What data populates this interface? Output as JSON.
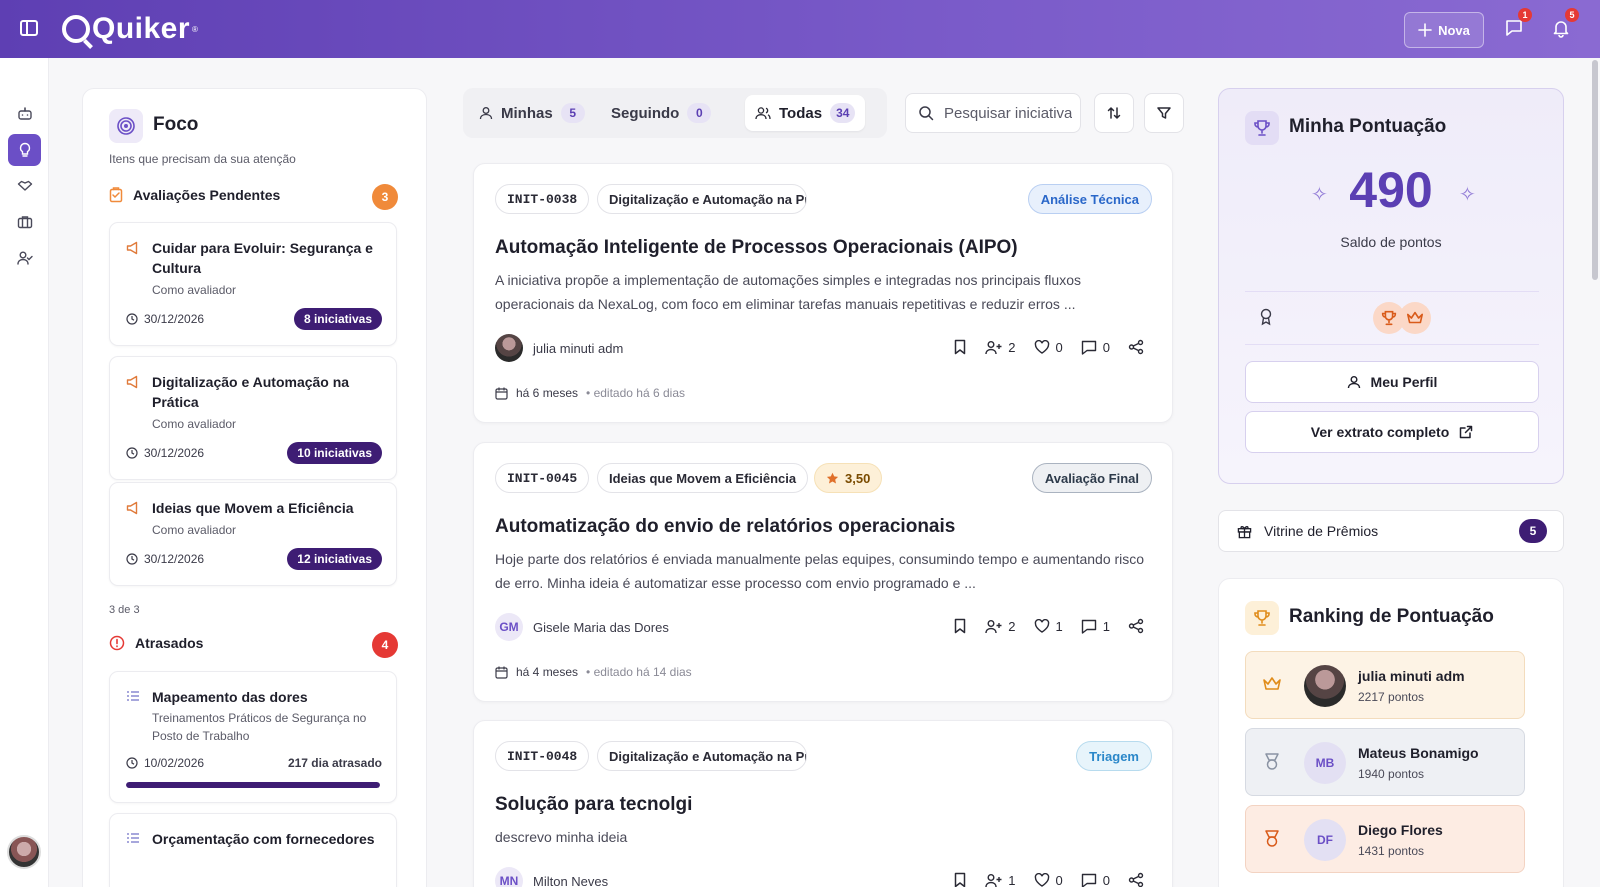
{
  "topbar": {
    "brand": "Quiker",
    "brand_mark": "®",
    "new_button_label": "Nova",
    "messages_badge": "1",
    "notifications_badge": "5"
  },
  "rail": {
    "items": [
      "robot-icon",
      "lightbulb-icon",
      "handshake-icon",
      "briefcase-icon",
      "user-check-icon"
    ]
  },
  "focus": {
    "title": "Foco",
    "subtitle": "Itens que precisam da sua atenção",
    "pending": {
      "title": "Avaliações Pendentes",
      "count": "3",
      "items": [
        {
          "title": "Cuidar para Evoluir: Segurança e Cultura",
          "role": "Como avaliador",
          "date": "30/12/2026",
          "badge": "8 iniciativas"
        },
        {
          "title": "Digitalização e Automação na Prática",
          "role": "Como avaliador",
          "date": "30/12/2026",
          "badge": "10 iniciativas"
        },
        {
          "title": "Ideias que Movem a Eficiência",
          "role": "Como avaliador",
          "date": "30/12/2026",
          "badge": "12 iniciativas"
        }
      ],
      "count_note": "3 de 3"
    },
    "late": {
      "title": "Atrasados",
      "count": "4",
      "items": [
        {
          "title": "Mapeamento das dores",
          "subtitle": "Treinamentos Práticos de Segurança no Posto de Trabalho",
          "date": "10/02/2026",
          "late": "217 dia atrasado",
          "progress": 1.0
        },
        {
          "title": "Orçamentação com fornecedores"
        }
      ]
    }
  },
  "tabs": [
    {
      "label": "Minhas",
      "count": "5"
    },
    {
      "label": "Seguindo",
      "count": "0"
    },
    {
      "label": "Todas",
      "count": "34",
      "active": true
    }
  ],
  "search": {
    "placeholder": "Pesquisar iniciativa"
  },
  "feed": [
    {
      "code": "INIT-0038",
      "campaign": "Digitalização e Automação na Pr",
      "status": "Análise Técnica",
      "title": "Automação Inteligente de Processos Operacionais (AIPO)",
      "desc": "A iniciativa propõe a implementação de automações simples e integradas nos principais fluxos operacionais da NexaLog, com foco em eliminar tarefas manuais repetitivas e reduzir erros ...",
      "author": "julia minuti adm",
      "followers": "2",
      "likes": "0",
      "comments": "0",
      "created": "há 6 meses",
      "edited": "• editado há 6 dias"
    },
    {
      "code": "INIT-0045",
      "campaign": "Ideias que Movem a Eficiência",
      "rating": "3,50",
      "status": "Avaliação Final",
      "title": "Automatização do envio de relatórios operacionais",
      "desc": "Hoje parte dos relatórios é enviada manualmente pelas equipes, consumindo tempo e aumentando risco de erro. Minha ideia é automatizar esse processo com envio programado e ...",
      "author_initials": "GM",
      "author": "Gisele Maria das Dores",
      "followers": "2",
      "likes": "1",
      "comments": "1",
      "created": "há 4 meses",
      "edited": "• editado há 14 dias"
    },
    {
      "code": "INIT-0048",
      "campaign": "Digitalização e Automação na Pr",
      "status": "Triagem",
      "title": "Solução para tecnolgi",
      "desc": "descrevo minha ideia",
      "author_initials": "MN",
      "author": "Milton Neves",
      "followers": "1",
      "likes": "0",
      "comments": "0"
    }
  ],
  "score": {
    "title": "Minha Pontuação",
    "value": "490",
    "label": "Saldo de pontos",
    "profile_button": "Meu Perfil",
    "statement_button": "Ver extrato completo"
  },
  "prizes": {
    "label": "Vitrine de Prêmios",
    "count": "5"
  },
  "ranking": {
    "title": "Ranking de Pontuação",
    "items": [
      {
        "name": "julia minuti adm",
        "points": "2217 pontos"
      },
      {
        "initials": "MB",
        "name": "Mateus Bonamigo",
        "points": "1940 pontos"
      },
      {
        "initials": "DF",
        "name": "Diego Flores",
        "points": "1431 pontos"
      }
    ]
  },
  "colors": {
    "brand": "#6b4fc6",
    "dark_badge": "#3e1d74",
    "status_analysis": "#2a67c9",
    "status_triage": "#2a87c9",
    "late_red": "#e53935",
    "pending_orange": "#f08a3a"
  }
}
